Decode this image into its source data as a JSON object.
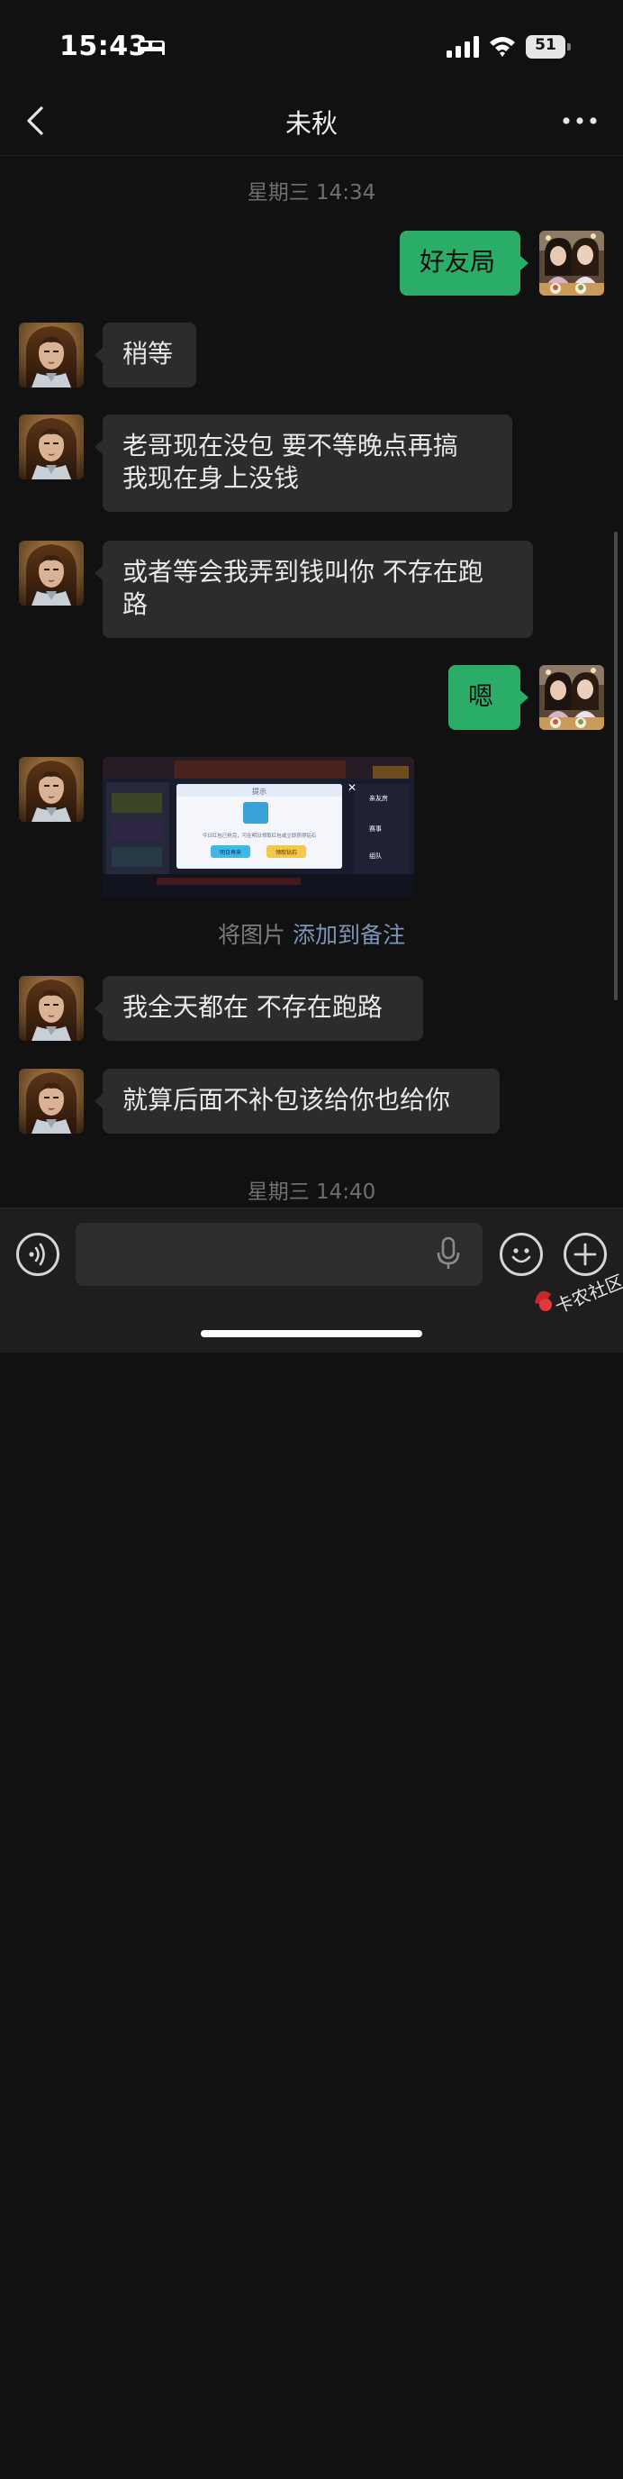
{
  "status_bar": {
    "time": "15:43",
    "battery": "51",
    "icons": [
      "bed-icon",
      "cellular-signal-icon",
      "wifi-icon",
      "battery-icon"
    ]
  },
  "nav": {
    "title": "未秋",
    "back_icon": "chevron-left-icon",
    "more_icon": "more-dots-icon"
  },
  "conversation": {
    "timestamps": [
      "星期三 14:34",
      "星期三 14:40"
    ],
    "messages": [
      {
        "side": "out",
        "text": "好友局"
      },
      {
        "side": "in",
        "text": "稍等"
      },
      {
        "side": "in",
        "line1": "老哥现在没包 要不等晚点再搞",
        "line2": "我现在身上没钱"
      },
      {
        "side": "in",
        "line1": "或者等会我弄到钱叫你 不存在跑",
        "line2": "路"
      },
      {
        "side": "out",
        "text": "嗯"
      },
      {
        "side": "in",
        "type": "image",
        "image": {
          "dialog_title": "提示",
          "dialog_text": "今日红包已抢完，可在明日领取红包或立即获得钻石",
          "btn_left": "明日再来",
          "btn_right": "领取钻石",
          "side_btn1": "亲友房",
          "side_btn2": "赛事",
          "side_btn3": "组队"
        }
      },
      {
        "side": "in",
        "text": "我全天都在 不存在跑路"
      },
      {
        "side": "in",
        "text": "就算后面不补包该给你也给你"
      }
    ],
    "image_note": {
      "prefix": "将图片",
      "link": "添加到备注"
    }
  },
  "input_bar": {
    "icons": [
      "voice-icon",
      "microphone-icon",
      "emoji-icon",
      "plus-icon"
    ]
  },
  "watermark": {
    "text": "卡农社区"
  },
  "colors": {
    "background": "#111111",
    "bubble_in": "#2c2c2c",
    "bubble_out": "#2aae67",
    "link": "#7e94b8"
  }
}
